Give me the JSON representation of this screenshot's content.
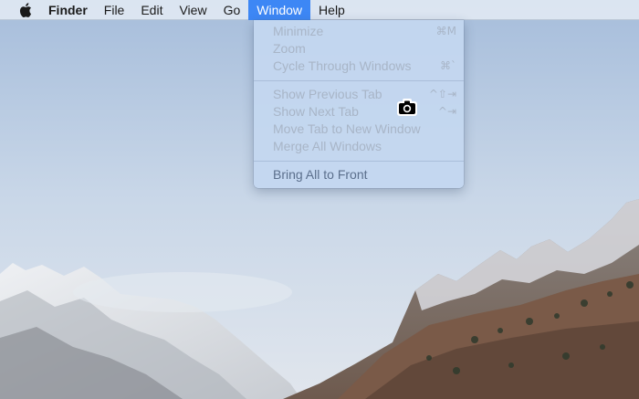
{
  "menubar": {
    "app_name": "Finder",
    "menus": [
      "File",
      "Edit",
      "View",
      "Go",
      "Window",
      "Help"
    ],
    "active_menu": "Window"
  },
  "window_menu": {
    "items": [
      {
        "label": "Minimize",
        "shortcut": "⌘M",
        "enabled": false
      },
      {
        "label": "Zoom",
        "shortcut": "",
        "enabled": false
      },
      {
        "label": "Cycle Through Windows",
        "shortcut": "⌘`",
        "enabled": false
      },
      {
        "label": "Show Previous Tab",
        "shortcut": "^⇧⇥",
        "enabled": false
      },
      {
        "label": "Show Next Tab",
        "shortcut": "^⇥",
        "enabled": false
      },
      {
        "label": "Move Tab to New Window",
        "shortcut": "",
        "enabled": false
      },
      {
        "label": "Merge All Windows",
        "shortcut": "",
        "enabled": false
      },
      {
        "label": "Bring All to Front",
        "shortcut": "",
        "enabled": true
      }
    ]
  },
  "icons": {
    "apple": "apple-logo-icon",
    "cursor": "screenshot-camera-icon"
  },
  "colors": {
    "menu_highlight": "#3d87f5"
  }
}
